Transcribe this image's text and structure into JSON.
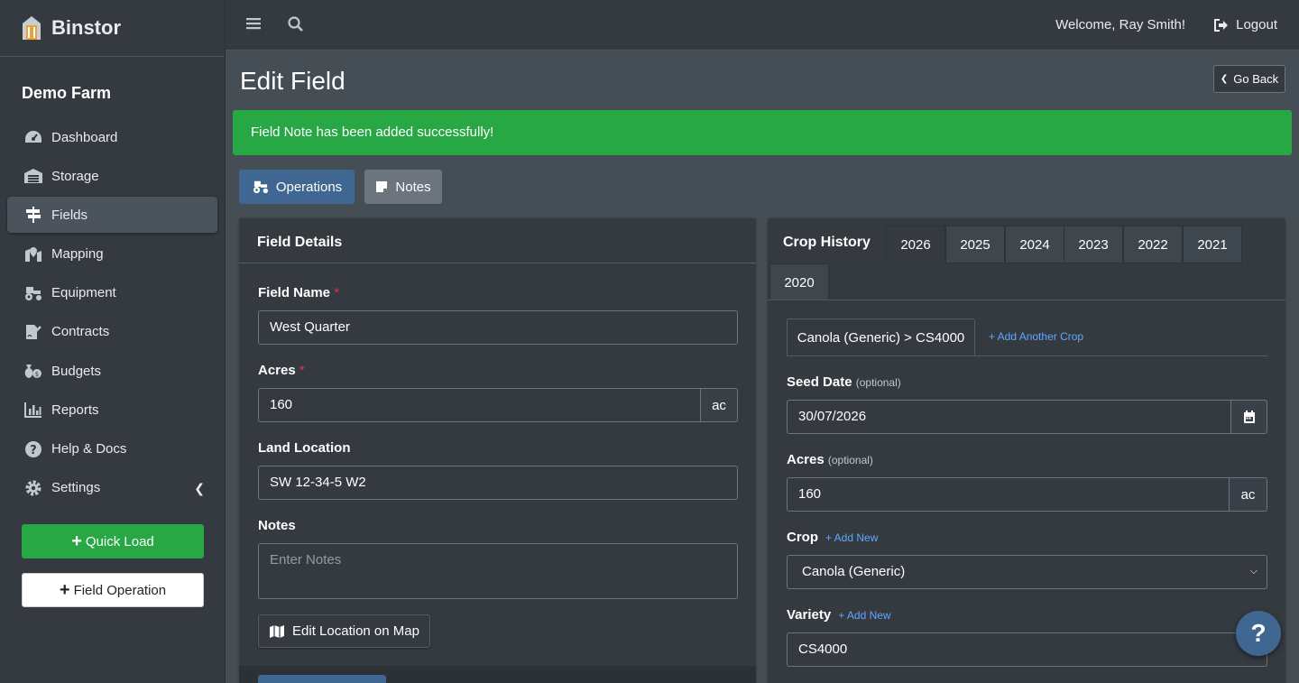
{
  "brand": {
    "name": "Binstor"
  },
  "farm": {
    "name": "Demo Farm"
  },
  "sidebar": {
    "items": [
      {
        "label": "Dashboard",
        "icon": "dashboard-icon"
      },
      {
        "label": "Storage",
        "icon": "warehouse-icon"
      },
      {
        "label": "Fields",
        "icon": "signpost-icon",
        "active": true
      },
      {
        "label": "Mapping",
        "icon": "map-marker-icon"
      },
      {
        "label": "Equipment",
        "icon": "tractor-icon"
      },
      {
        "label": "Contracts",
        "icon": "file-signature-icon"
      },
      {
        "label": "Budgets",
        "icon": "money-bags-icon"
      },
      {
        "label": "Reports",
        "icon": "bar-chart-icon"
      },
      {
        "label": "Help & Docs",
        "icon": "question-circle-icon"
      },
      {
        "label": "Settings",
        "icon": "gear-icon"
      }
    ],
    "quick_load": "Quick Load",
    "field_operation": "Field Operation"
  },
  "topbar": {
    "welcome": "Welcome, Ray Smith!",
    "logout": "Logout"
  },
  "page": {
    "title": "Edit Field",
    "go_back": "Go Back"
  },
  "alert": {
    "message": "Field Note has been added successfully!"
  },
  "tabs": {
    "operations": "Operations",
    "notes": "Notes"
  },
  "field_details": {
    "title": "Field Details",
    "field_name_label": "Field Name",
    "field_name_value": "West Quarter",
    "acres_label": "Acres",
    "acres_value": "160",
    "acres_unit": "ac",
    "land_location_label": "Land Location",
    "land_location_value": "SW 12-34-5 W2",
    "notes_label": "Notes",
    "notes_placeholder": "Enter Notes",
    "edit_map_button": "Edit Location on Map",
    "required_mark": "*"
  },
  "crop_history": {
    "title": "Crop History",
    "years": [
      "2026",
      "2025",
      "2024",
      "2023",
      "2022",
      "2021",
      "2020"
    ],
    "active_year": "2026",
    "crop_tab": "Canola (Generic) > CS4000",
    "add_another_crop": "+ Add Another Crop",
    "seed_date_label": "Seed Date",
    "optional": "(optional)",
    "seed_date_value": "30/07/2026",
    "acres_label": "Acres",
    "acres_value": "160",
    "acres_unit": "ac",
    "crop_label": "Crop",
    "add_new": "+ Add New",
    "crop_value": "Canola (Generic)",
    "variety_label": "Variety",
    "variety_value": "CS4000"
  },
  "help": {
    "label": "?"
  },
  "colors": {
    "success": "#28a745",
    "primary": "#3f6791",
    "sidebar": "#343a40",
    "content": "#454d55"
  }
}
